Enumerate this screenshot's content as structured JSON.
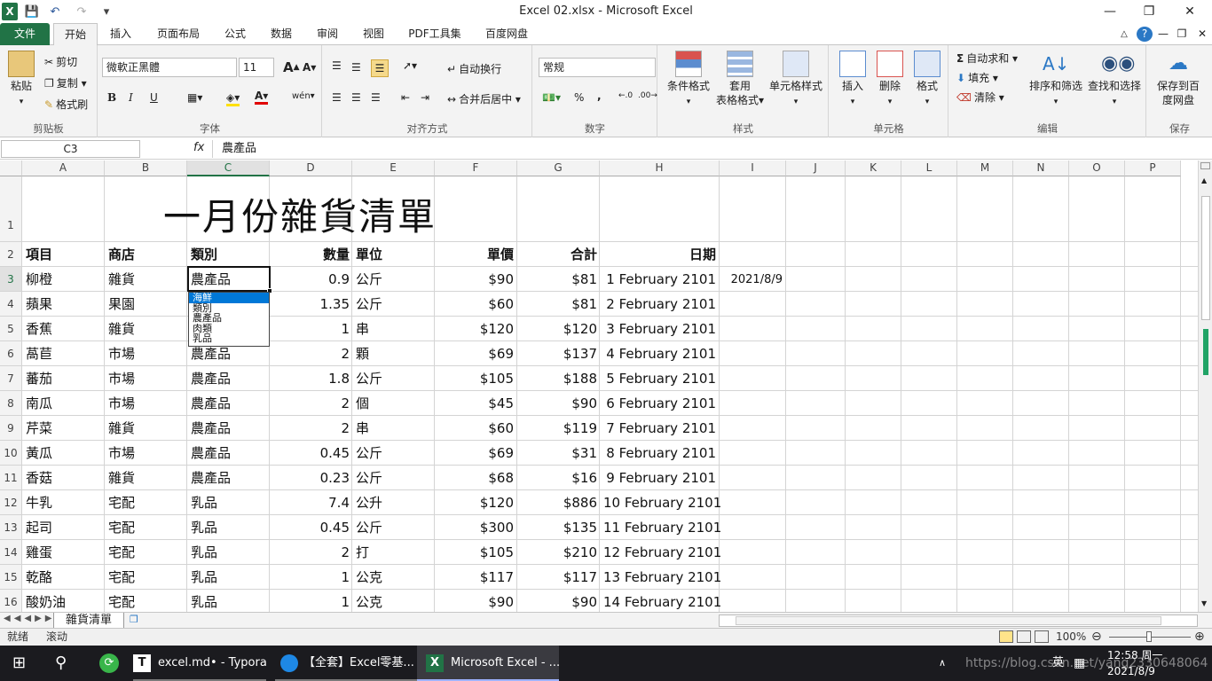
{
  "window": {
    "title": "Excel 02.xlsx  -  Microsoft Excel",
    "quick_access": [
      "excel-logo",
      "save-icon",
      "undo-icon",
      "redo-icon",
      "customize-icon"
    ]
  },
  "tabs": [
    "文件",
    "开始",
    "插入",
    "页面布局",
    "公式",
    "数据",
    "审阅",
    "视图",
    "PDF工具集",
    "百度网盘"
  ],
  "ribbon": {
    "clipboard": {
      "paste": "粘贴",
      "cut": "剪切",
      "copy": "复制",
      "format_painter": "格式刷",
      "label": "剪贴板"
    },
    "font": {
      "name": "微軟正黑體",
      "size": "11",
      "bold": "B",
      "italic": "I",
      "underline": "U",
      "label": "字体"
    },
    "alignment": {
      "wrap": "自动换行",
      "merge": "合并后居中",
      "label": "对齐方式"
    },
    "number": {
      "format": "常规",
      "percent": "%",
      "comma": ",",
      "label": "数字"
    },
    "styles": {
      "conditional": "条件格式",
      "table_format_1": "套用",
      "table_format_2": "表格格式",
      "cell_styles": "单元格样式",
      "label": "样式"
    },
    "cells": {
      "insert": "插入",
      "delete": "删除",
      "format": "格式",
      "label": "单元格"
    },
    "editing": {
      "autosum": "自动求和",
      "fill": "填充",
      "clear": "清除",
      "sort": "排序和筛选",
      "find": "查找和选择",
      "label": "编辑"
    },
    "save": {
      "line1": "保存到百",
      "line2": "度网盘",
      "label": "保存"
    }
  },
  "formula_bar": {
    "name_box": "C3",
    "fx": "fx",
    "value": "農產品"
  },
  "columns": [
    "A",
    "B",
    "C",
    "D",
    "E",
    "F",
    "G",
    "H",
    "I",
    "J",
    "K",
    "L",
    "M",
    "N",
    "O",
    "P"
  ],
  "selected_column": "C",
  "selected_row": 3,
  "sheet": {
    "title": "一月份雜貨清單",
    "headers": {
      "item": "項目",
      "store": "商店",
      "category": "類別",
      "qty": "數量",
      "unit": "單位",
      "price": "單價",
      "total": "合計",
      "date": "日期"
    },
    "rows": [
      {
        "row": "3",
        "item": "柳橙",
        "store": "雜貨",
        "category": "農產品",
        "qty": "0.9",
        "unit": "公斤",
        "price": "$90",
        "total": "$81",
        "date": "1 February 2101",
        "extra": "2021/8/9"
      },
      {
        "row": "4",
        "item": "蘋果",
        "store": "果園",
        "category": "",
        "qty": "1.35",
        "unit": "公斤",
        "price": "$60",
        "total": "$81",
        "date": "2 February 2101",
        "extra": ""
      },
      {
        "row": "5",
        "item": "香蕉",
        "store": "雜貨",
        "category": "",
        "qty": "1",
        "unit": "串",
        "price": "$120",
        "total": "$120",
        "date": "3 February 2101",
        "extra": ""
      },
      {
        "row": "6",
        "item": "萵苣",
        "store": "市場",
        "category": "農產品",
        "qty": "2",
        "unit": "顆",
        "price": "$69",
        "total": "$137",
        "date": "4 February 2101",
        "extra": ""
      },
      {
        "row": "7",
        "item": "蕃茄",
        "store": "市場",
        "category": "農產品",
        "qty": "1.8",
        "unit": "公斤",
        "price": "$105",
        "total": "$188",
        "date": "5 February 2101",
        "extra": ""
      },
      {
        "row": "8",
        "item": "南瓜",
        "store": "市場",
        "category": "農產品",
        "qty": "2",
        "unit": "個",
        "price": "$45",
        "total": "$90",
        "date": "6 February 2101",
        "extra": ""
      },
      {
        "row": "9",
        "item": "芹菜",
        "store": "雜貨",
        "category": "農產品",
        "qty": "2",
        "unit": "串",
        "price": "$60",
        "total": "$119",
        "date": "7 February 2101",
        "extra": ""
      },
      {
        "row": "10",
        "item": "黃瓜",
        "store": "市場",
        "category": "農產品",
        "qty": "0.45",
        "unit": "公斤",
        "price": "$69",
        "total": "$31",
        "date": "8 February 2101",
        "extra": ""
      },
      {
        "row": "11",
        "item": "香菇",
        "store": "雜貨",
        "category": "農產品",
        "qty": "0.23",
        "unit": "公斤",
        "price": "$68",
        "total": "$16",
        "date": "9 February 2101",
        "extra": ""
      },
      {
        "row": "12",
        "item": "牛乳",
        "store": "宅配",
        "category": "乳品",
        "qty": "7.4",
        "unit": "公升",
        "price": "$120",
        "total": "$886",
        "date": "10 February 2101",
        "extra": ""
      },
      {
        "row": "13",
        "item": "起司",
        "store": "宅配",
        "category": "乳品",
        "qty": "0.45",
        "unit": "公斤",
        "price": "$300",
        "total": "$135",
        "date": "11 February 2101",
        "extra": ""
      },
      {
        "row": "14",
        "item": "雞蛋",
        "store": "宅配",
        "category": "乳品",
        "qty": "2",
        "unit": "打",
        "price": "$105",
        "total": "$210",
        "date": "12 February 2101",
        "extra": ""
      },
      {
        "row": "15",
        "item": "乾酪",
        "store": "宅配",
        "category": "乳品",
        "qty": "1",
        "unit": "公克",
        "price": "$117",
        "total": "$117",
        "date": "13 February 2101",
        "extra": ""
      },
      {
        "row": "16",
        "item": "酸奶油",
        "store": "宅配",
        "category": "乳品",
        "qty": "1",
        "unit": "公克",
        "price": "$90",
        "total": "$90",
        "date": "14 February 2101",
        "extra": ""
      }
    ]
  },
  "dropdown": {
    "options": [
      "海鮮",
      "類別",
      "農產品",
      "肉類",
      "乳品"
    ],
    "highlighted": "海鮮"
  },
  "sheet_tab": "雜貨清單",
  "status": {
    "ready": "就绪",
    "scroll": "滚动",
    "zoom": "100%"
  },
  "taskbar": {
    "apps": [
      "excel.md• - Typora",
      "【全套】Excel零基...",
      "Microsoft Excel - ..."
    ],
    "ime": "英",
    "time": "12:58 周一",
    "date": "2021/8/9",
    "watermark": "https://blog.csdn.net/yang2330648064"
  },
  "colors": {
    "accent": "#217346",
    "highlight": "#0078d7"
  }
}
